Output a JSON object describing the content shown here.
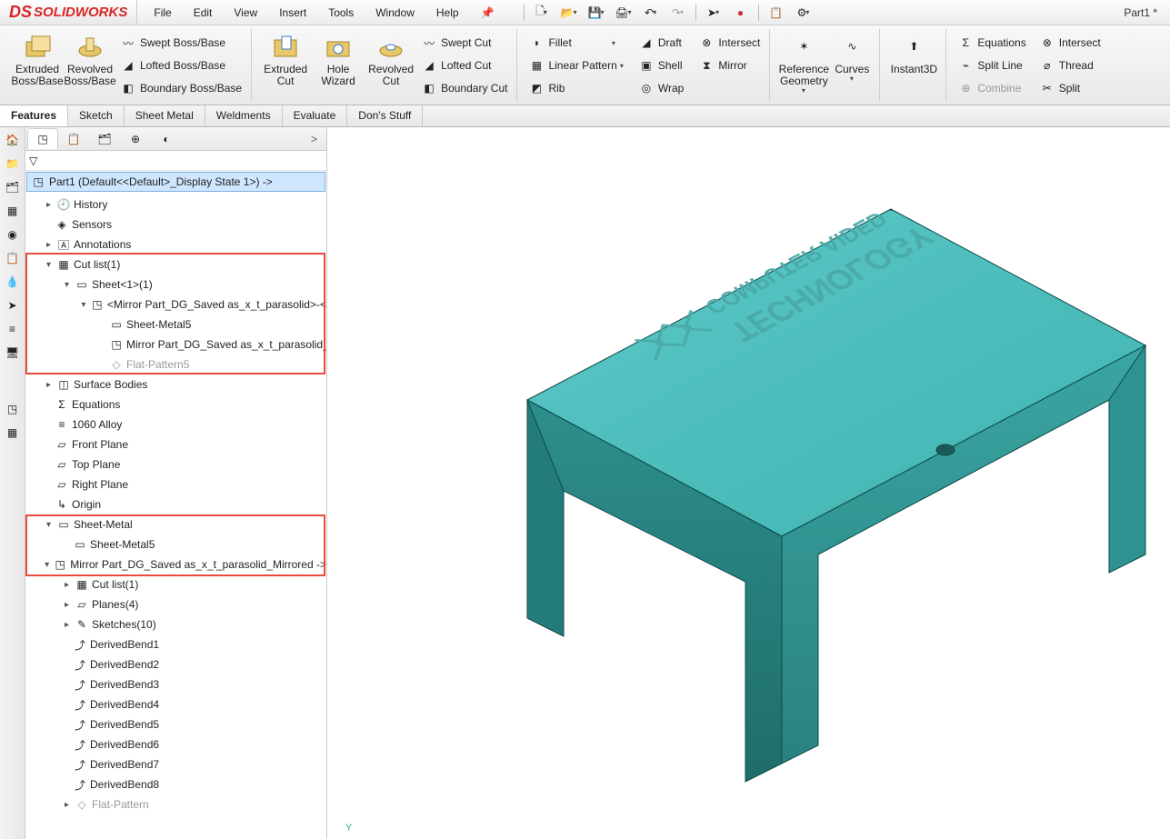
{
  "app": {
    "brand": "SOLIDWORKS",
    "doc_title": "Part1 *"
  },
  "menu": {
    "file": "File",
    "edit": "Edit",
    "view": "View",
    "insert": "Insert",
    "tools": "Tools",
    "window": "Window",
    "help": "Help"
  },
  "ribbon": {
    "extruded_boss": "Extruded Boss/Base",
    "revolved_boss": "Revolved Boss/Base",
    "swept_boss": "Swept Boss/Base",
    "lofted_boss": "Lofted Boss/Base",
    "boundary_boss": "Boundary Boss/Base",
    "extruded_cut": "Extruded Cut",
    "hole_wizard": "Hole Wizard",
    "revolved_cut": "Revolved Cut",
    "swept_cut": "Swept Cut",
    "lofted_cut": "Lofted Cut",
    "boundary_cut": "Boundary Cut",
    "fillet": "Fillet",
    "linear_pattern": "Linear Pattern",
    "rib": "Rib",
    "draft": "Draft",
    "shell": "Shell",
    "wrap": "Wrap",
    "intersect": "Intersect",
    "mirror": "Mirror",
    "ref_geom": "Reference Geometry",
    "curves": "Curves",
    "instant3d": "Instant3D",
    "equations": "Equations",
    "split_line": "Split Line",
    "combine": "Combine",
    "intersect2": "Intersect",
    "thread": "Thread",
    "split": "Split"
  },
  "tabs": {
    "features": "Features",
    "sketch": "Sketch",
    "sheetmetal": "Sheet Metal",
    "weldments": "Weldments",
    "evaluate": "Evaluate",
    "dons": "Don's Stuff"
  },
  "tree": {
    "root": "Part1  (Default<<Default>_Display State 1>) ->",
    "history": "History",
    "sensors": "Sensors",
    "annotations": "Annotations",
    "cutlist": "Cut list(1)",
    "sheet1": "Sheet<1>(1)",
    "mirrorpart_long": "<Mirror Part_DG_Saved as_x_t_parasolid>-<",
    "sheetmetal5": "Sheet-Metal5",
    "mirrorpart2": "Mirror Part_DG_Saved as_x_t_parasolid_",
    "flatpat5": "Flat-Pattern5",
    "surface_bodies": "Surface Bodies",
    "equations": "Equations",
    "alloy": "1060 Alloy",
    "front": "Front Plane",
    "top": "Top Plane",
    "right": "Right Plane",
    "origin": "Origin",
    "sheetmetal": "Sheet-Metal",
    "sheetmetal5b": "Sheet-Metal5",
    "mirrored": "Mirror Part_DG_Saved as_x_t_parasolid_Mirrored ->",
    "cutlist2": "Cut list(1)",
    "planes4": "Planes(4)",
    "sketches10": "Sketches(10)",
    "db1": "DerivedBend1",
    "db2": "DerivedBend2",
    "db3": "DerivedBend3",
    "db4": "DerivedBend4",
    "db5": "DerivedBend5",
    "db6": "DerivedBend6",
    "db7": "DerivedBend7",
    "db8": "DerivedBend8",
    "flatpattern": "Flat-Pattern"
  },
  "viewport": {
    "axis_y": "Y"
  }
}
